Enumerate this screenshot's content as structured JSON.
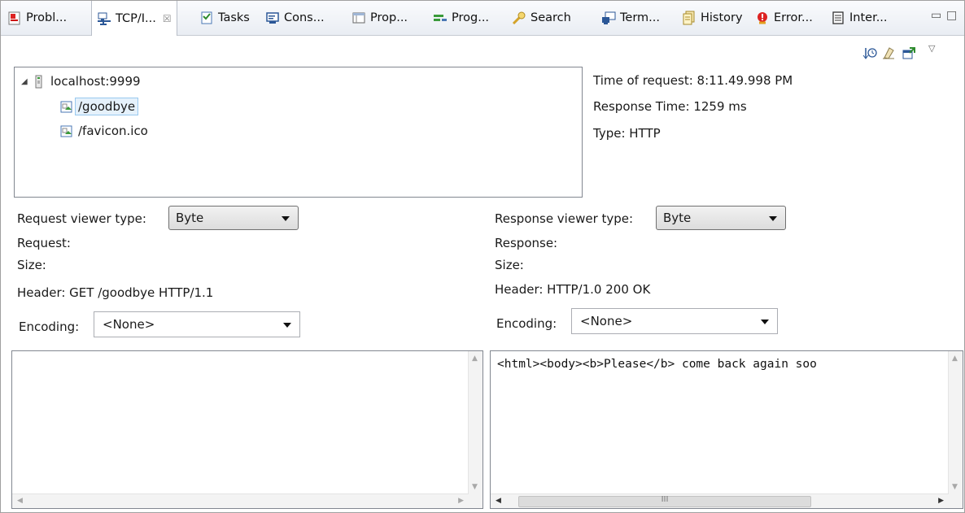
{
  "tabs": [
    {
      "label": "Probl...",
      "icon": "problems-icon"
    },
    {
      "label": "TCP/I...",
      "icon": "tcpip-monitor-icon",
      "close": "☒"
    },
    {
      "label": "Tasks",
      "icon": "tasks-icon"
    },
    {
      "label": "Cons...",
      "icon": "console-icon"
    },
    {
      "label": "Prop...",
      "icon": "properties-icon"
    },
    {
      "label": "Prog...",
      "icon": "progress-icon"
    },
    {
      "label": "Search",
      "icon": "search-icon"
    },
    {
      "label": "Term...",
      "icon": "terminal-icon"
    },
    {
      "label": "History",
      "icon": "history-icon"
    },
    {
      "label": "Error...",
      "icon": "error-log-icon"
    },
    {
      "label": "Inter...",
      "icon": "internal-web-browser-icon"
    }
  ],
  "tree": {
    "root": "localhost:9999",
    "children": [
      "/goodbye",
      "/favicon.ico"
    ],
    "selected": "/goodbye"
  },
  "info": {
    "time_of_request": "Time of request: 8:11.49.998 PM",
    "response_time": "Response Time: 1259 ms",
    "type": "Type: HTTP"
  },
  "request": {
    "viewer_label": "Request viewer type:",
    "viewer_value": "Byte",
    "title": "Request:",
    "size": "Size:",
    "header": "Header: GET /goodbye HTTP/1.1",
    "encoding_label": "Encoding:",
    "encoding_value": "<None>",
    "body": ""
  },
  "response": {
    "viewer_label": "Response viewer type:",
    "viewer_value": "Byte",
    "title": "Response:",
    "size": "Size:",
    "header": "Header: HTTP/1.0 200 OK",
    "encoding_label": "Encoding:",
    "encoding_value": "<None>",
    "body": "<html><body><b>Please</b> come back again soo"
  },
  "scroll": {
    "thumb_grip": "III"
  }
}
